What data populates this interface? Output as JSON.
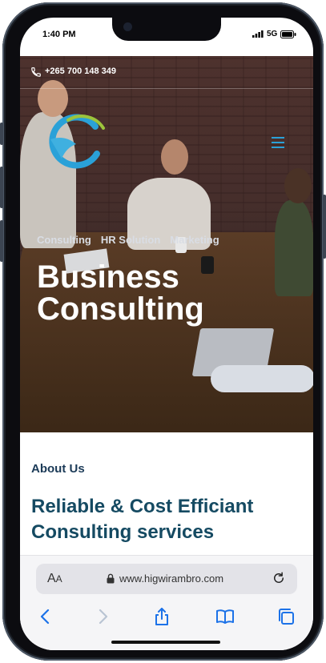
{
  "status_bar": {
    "time": "1:40 PM",
    "network": "5G"
  },
  "site": {
    "contact_phone": "+265 700 148 349",
    "nav": [
      "Consulting",
      "HR Solution",
      "Marketing"
    ],
    "hero_title": "Business Consulting",
    "about_label": "About Us",
    "headline": "Reliable & Cost Efficiant Consulting services"
  },
  "browser": {
    "text_size_label": "AA",
    "url": "www.higwirambro.com"
  },
  "icons": [
    "phone-icon",
    "logo",
    "menu-icon",
    "lock-icon",
    "reload-icon",
    "back-icon",
    "forward-icon",
    "share-icon",
    "bookmarks-icon",
    "tabs-icon"
  ],
  "colors": {
    "heading": "#154a62",
    "about": "#1b3a57",
    "logo_blue": "#2aa1d8",
    "logo_green": "#9cc43c"
  }
}
